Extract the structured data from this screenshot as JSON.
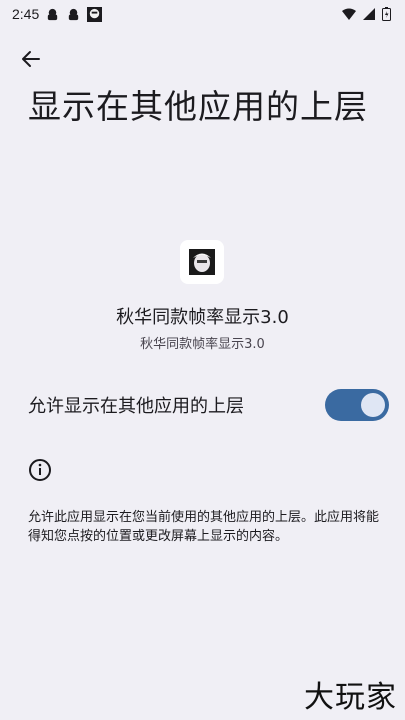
{
  "status_bar": {
    "time": "2:45",
    "icons_left": [
      "notification-icon",
      "notification-icon",
      "app-notification-icon"
    ],
    "icons_right": [
      "wifi-icon",
      "signal-icon",
      "battery-icon"
    ]
  },
  "header": {
    "back_icon": "arrow-back-icon",
    "title": "显示在其他应用的上层"
  },
  "app": {
    "icon": "app-icon",
    "name": "秋华同款帧率显示3.0",
    "package_label": "秋华同款帧率显示3.0"
  },
  "permission": {
    "label": "允许显示在其他应用的上层",
    "enabled": true
  },
  "info": {
    "icon": "info-icon",
    "description": "允许此应用显示在您当前使用的其他应用的上层。此应用将能得知您点按的位置或更改屏幕上显示的内容。"
  },
  "watermark": {
    "text": "大玩家"
  },
  "colors": {
    "background": "#f0eff5",
    "switch_track": "#3a6aa1",
    "switch_thumb": "#dfe6f4",
    "text_primary": "#1c1b1f"
  }
}
